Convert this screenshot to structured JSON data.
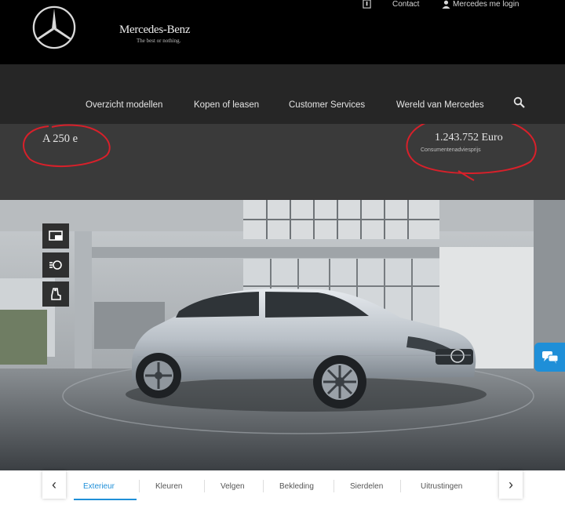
{
  "header": {
    "brand": "Mercedes-Benz",
    "tagline": "The best or nothing.",
    "contact_label": "Contact",
    "login_label": "Mercedes me login"
  },
  "nav": {
    "items": [
      "Overzicht modellen",
      "Kopen of leasen",
      "Customer Services",
      "Wereld van Mercedes"
    ]
  },
  "model": {
    "name": "A 250 e",
    "price": "1.243.752 Euro",
    "price_note": "Consumentenadviesprijs"
  },
  "tools": {
    "icons": [
      "screen-icon",
      "lighting-icon",
      "seat-icon"
    ]
  },
  "tabs": {
    "items": [
      "Exterieur",
      "Kleuren",
      "Velgen",
      "Bekleding",
      "Sierdelen",
      "Uitrustingen"
    ],
    "active": "Exterieur"
  },
  "colors": {
    "header_bg": "#000000",
    "nav_bg": "#262626",
    "info_bg": "#3a3a3a",
    "accent": "#1f8fd8",
    "annotation": "#d8202a"
  }
}
